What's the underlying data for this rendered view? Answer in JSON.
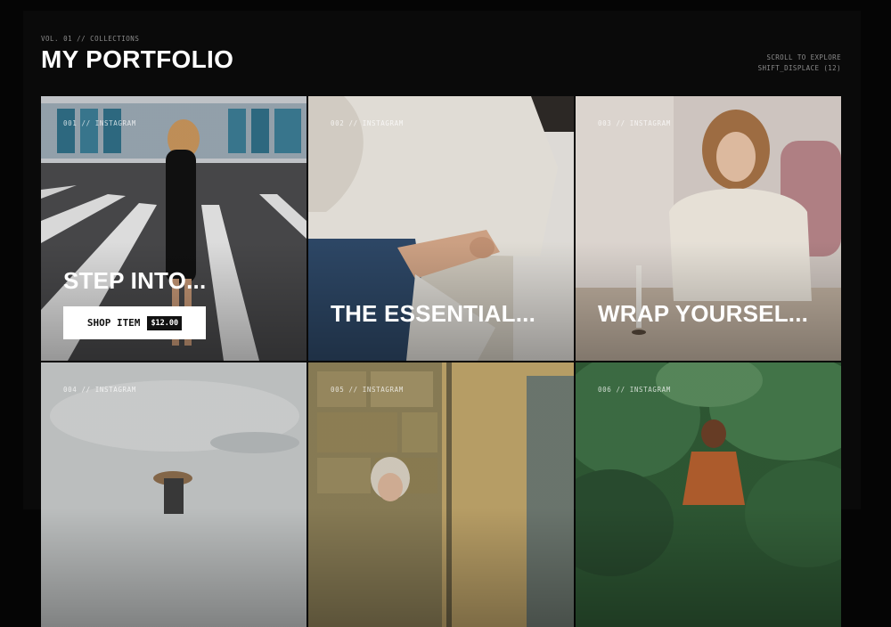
{
  "header": {
    "eyebrow": "VOL. 01 // COLLECTIONS",
    "title": "MY PORTFOLIO",
    "hint_line1": "SCROLL TO EXPLORE",
    "hint_line2": "SHIFT_DISPLACE (12)"
  },
  "cards": [
    {
      "tag": "001 // INSTAGRAM",
      "caption": "STEP INTO...",
      "shop_label": "SHOP ITEM",
      "price": "$12.00"
    },
    {
      "tag": "002 // INSTAGRAM",
      "caption": "THE ESSENTIAL..."
    },
    {
      "tag": "003 // INSTAGRAM",
      "caption": "WRAP YOURSEL..."
    },
    {
      "tag": "004 // INSTAGRAM"
    },
    {
      "tag": "005 // INSTAGRAM"
    },
    {
      "tag": "006 // INSTAGRAM"
    }
  ],
  "colors": {
    "background": "#050505",
    "panel": "#0a0a0a",
    "accent": "#ffffff",
    "muted": "#8a8a8a"
  }
}
